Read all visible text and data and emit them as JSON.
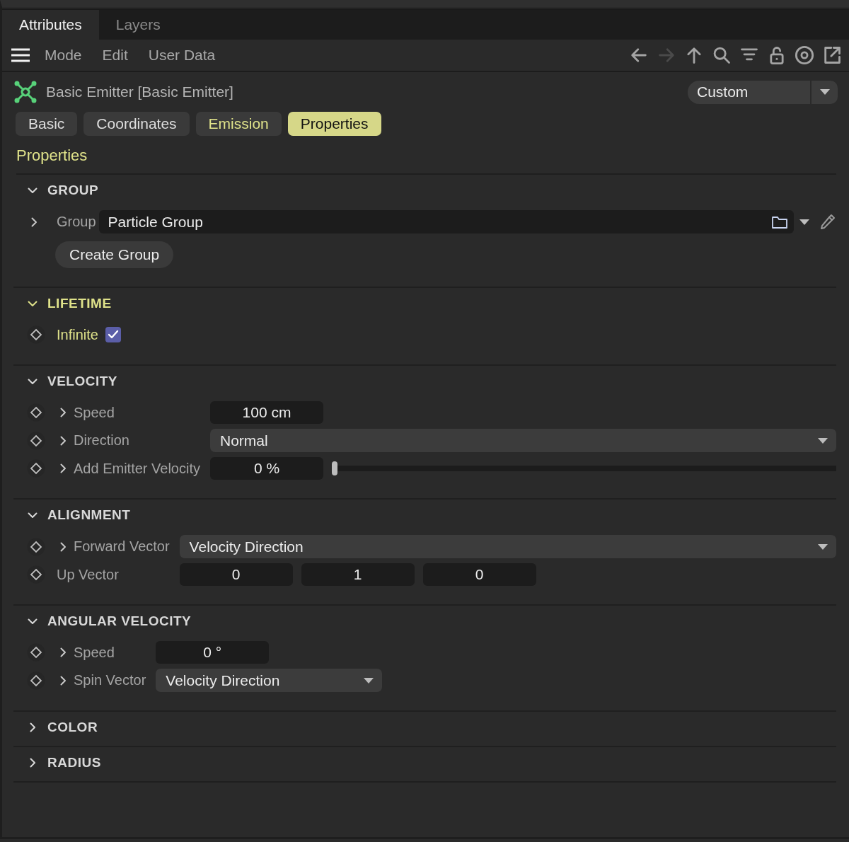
{
  "panel_tabs": [
    {
      "label": "Attributes",
      "selected": true
    },
    {
      "label": "Layers",
      "selected": false
    }
  ],
  "menu": [
    "Mode",
    "Edit",
    "User Data"
  ],
  "toolbar": [
    {
      "kind": "back",
      "disabled": false
    },
    {
      "kind": "forward",
      "disabled": true
    },
    {
      "kind": "up",
      "disabled": false
    },
    {
      "kind": "search",
      "disabled": false
    },
    {
      "kind": "filter",
      "disabled": false
    },
    {
      "kind": "lock",
      "disabled": false
    },
    {
      "kind": "target",
      "disabled": false
    },
    {
      "kind": "new-window",
      "disabled": false
    }
  ],
  "object": {
    "title": "Basic Emitter [Basic Emitter]",
    "preset": "Custom"
  },
  "tabs": [
    {
      "label": "Basic",
      "selected": false,
      "highlighted": false
    },
    {
      "label": "Coordinates",
      "selected": false,
      "highlighted": false
    },
    {
      "label": "Emission",
      "selected": false,
      "highlighted": true
    },
    {
      "label": "Properties",
      "selected": true,
      "highlighted": false
    }
  ],
  "page_title": "Properties",
  "sections": [
    {
      "title": "GROUP",
      "expanded": true,
      "highlighted": false,
      "rows": [
        {
          "kind": "link",
          "label": "Group",
          "keyframe": false,
          "has_children": true,
          "highlighted": false,
          "value": "Particle Group"
        },
        {
          "kind": "button",
          "label": "Create Group"
        }
      ]
    },
    {
      "title": "LIFETIME",
      "expanded": true,
      "highlighted": true,
      "rows": [
        {
          "kind": "checkbox",
          "label": "Infinite",
          "keyframe": true,
          "has_children": false,
          "highlighted": true,
          "checked": true
        }
      ]
    },
    {
      "title": "VELOCITY",
      "expanded": true,
      "highlighted": false,
      "rows": [
        {
          "kind": "number",
          "label": "Speed",
          "keyframe": true,
          "has_children": true,
          "highlighted": false,
          "value": "100 cm"
        },
        {
          "kind": "dropdown",
          "label": "Direction",
          "keyframe": true,
          "has_children": true,
          "highlighted": false,
          "value": "Normal",
          "wide": true
        },
        {
          "kind": "slider",
          "label": "Add Emitter Velocity",
          "keyframe": true,
          "has_children": true,
          "highlighted": false,
          "value": "0 %",
          "level": 0
        }
      ]
    },
    {
      "title": "ALIGNMENT",
      "expanded": true,
      "highlighted": false,
      "rows": [
        {
          "kind": "dropdown",
          "label": "Forward Vector",
          "keyframe": true,
          "has_children": true,
          "highlighted": false,
          "value": "Velocity Direction",
          "wide": true
        },
        {
          "kind": "vector",
          "label": "Up Vector",
          "keyframe": true,
          "has_children": false,
          "highlighted": false,
          "values": [
            "0",
            "1",
            "0"
          ]
        }
      ]
    },
    {
      "title": "ANGULAR VELOCITY",
      "expanded": true,
      "highlighted": false,
      "rows": [
        {
          "kind": "number",
          "label": "Speed",
          "keyframe": true,
          "has_children": true,
          "highlighted": false,
          "value": "0 °"
        },
        {
          "kind": "dropdown",
          "label": "Spin Vector",
          "keyframe": true,
          "has_children": true,
          "highlighted": false,
          "value": "Velocity Direction",
          "wide": false
        }
      ]
    },
    {
      "title": "COLOR",
      "expanded": false,
      "highlighted": false
    },
    {
      "title": "RADIUS",
      "expanded": false,
      "highlighted": false
    }
  ]
}
